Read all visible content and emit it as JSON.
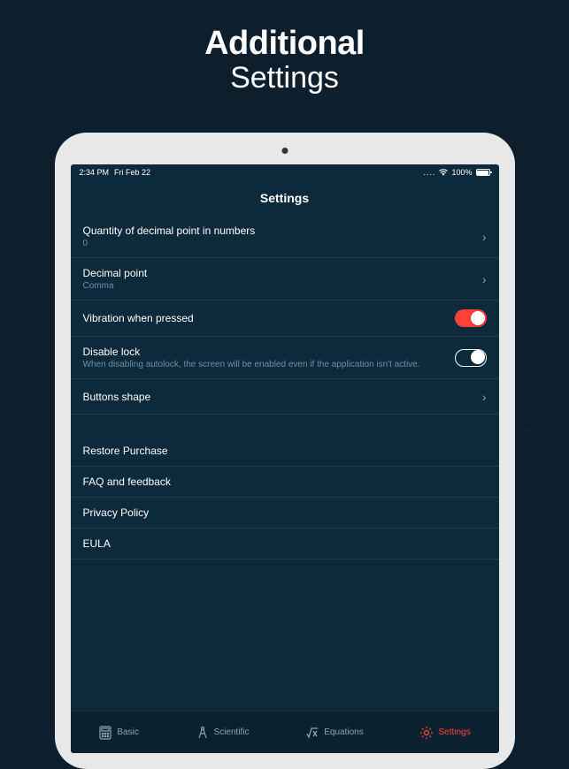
{
  "header": {
    "line1": "Additional",
    "line2": "Settings"
  },
  "statusBar": {
    "time": "2:34 PM",
    "date": "Fri Feb 22",
    "battery": "100%"
  },
  "navTitle": "Settings",
  "rows": {
    "decimalQty": {
      "title": "Quantity of decimal point in numbers",
      "value": "0"
    },
    "decimalPoint": {
      "title": "Decimal point",
      "value": "Comma"
    },
    "vibration": {
      "title": "Vibration when pressed",
      "on": true
    },
    "disableLock": {
      "title": "Disable lock",
      "sub": "When disabling autolock, the screen will be enabled even if the application isn't active.",
      "on": true
    },
    "buttonsShape": {
      "title": "Buttons shape"
    }
  },
  "links": {
    "restore": "Restore Purchase",
    "faq": "FAQ and feedback",
    "privacy": "Privacy Policy",
    "eula": "EULA"
  },
  "tabs": {
    "basic": "Basic",
    "scientific": "Scientific",
    "equations": "Equations",
    "settings": "Settings"
  }
}
